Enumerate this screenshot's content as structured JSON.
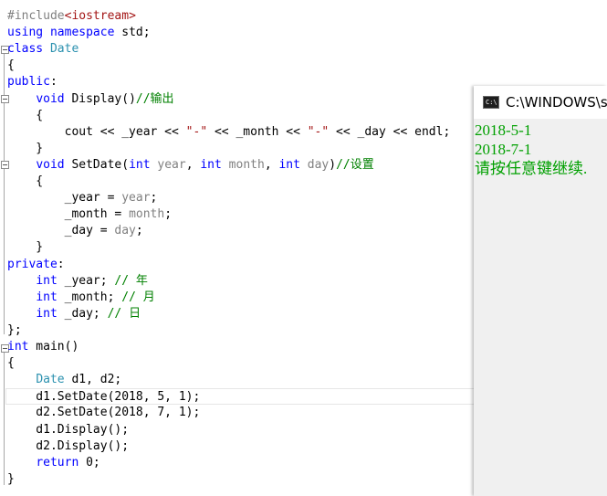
{
  "editor": {
    "lines": [
      [
        [
          "pp",
          "#include"
        ],
        [
          "st",
          "<iostream>"
        ]
      ],
      [
        [
          "kw",
          "using"
        ],
        [
          "tx",
          " "
        ],
        [
          "kw",
          "namespace"
        ],
        [
          "tx",
          " std;"
        ]
      ],
      [
        [
          "kw",
          "class"
        ],
        [
          "tx",
          " "
        ],
        [
          "ty",
          "Date"
        ]
      ],
      [
        [
          "tx",
          "{"
        ]
      ],
      [
        [
          "kw",
          "public"
        ],
        [
          "tx",
          ":"
        ]
      ],
      [
        [
          "tx",
          "    "
        ],
        [
          "kw",
          "void"
        ],
        [
          "tx",
          " Display()"
        ],
        [
          "cm",
          "//输出"
        ]
      ],
      [
        [
          "tx",
          "    {"
        ]
      ],
      [
        [
          "tx",
          "        cout << _year << "
        ],
        [
          "st",
          "\"-\""
        ],
        [
          "tx",
          " << _month << "
        ],
        [
          "st",
          "\"-\""
        ],
        [
          "tx",
          " << _day << endl;"
        ]
      ],
      [
        [
          "tx",
          "    }"
        ]
      ],
      [
        [
          "tx",
          "    "
        ],
        [
          "kw",
          "void"
        ],
        [
          "tx",
          " SetDate("
        ],
        [
          "kw",
          "int"
        ],
        [
          "tx",
          " "
        ],
        [
          "pa",
          "year"
        ],
        [
          "tx",
          ", "
        ],
        [
          "kw",
          "int"
        ],
        [
          "tx",
          " "
        ],
        [
          "pa",
          "month"
        ],
        [
          "tx",
          ", "
        ],
        [
          "kw",
          "int"
        ],
        [
          "tx",
          " "
        ],
        [
          "pa",
          "day"
        ],
        [
          "tx",
          ")"
        ],
        [
          "cm",
          "//设置"
        ]
      ],
      [
        [
          "tx",
          "    {"
        ]
      ],
      [
        [
          "tx",
          "        _year = "
        ],
        [
          "pa",
          "year"
        ],
        [
          "tx",
          ";"
        ]
      ],
      [
        [
          "tx",
          "        _month = "
        ],
        [
          "pa",
          "month"
        ],
        [
          "tx",
          ";"
        ]
      ],
      [
        [
          "tx",
          "        _day = "
        ],
        [
          "pa",
          "day"
        ],
        [
          "tx",
          ";"
        ]
      ],
      [
        [
          "tx",
          "    }"
        ]
      ],
      [
        [
          "kw",
          "private"
        ],
        [
          "tx",
          ":"
        ]
      ],
      [
        [
          "tx",
          "    "
        ],
        [
          "kw",
          "int"
        ],
        [
          "tx",
          " _year; "
        ],
        [
          "cm",
          "// 年"
        ]
      ],
      [
        [
          "tx",
          "    "
        ],
        [
          "kw",
          "int"
        ],
        [
          "tx",
          " _month; "
        ],
        [
          "cm",
          "// 月"
        ]
      ],
      [
        [
          "tx",
          "    "
        ],
        [
          "kw",
          "int"
        ],
        [
          "tx",
          " _day; "
        ],
        [
          "cm",
          "// 日"
        ]
      ],
      [
        [
          "tx",
          "};"
        ]
      ],
      [
        [
          "kw",
          "int"
        ],
        [
          "tx",
          " main()"
        ]
      ],
      [
        [
          "tx",
          "{"
        ]
      ],
      [
        [
          "tx",
          "    "
        ],
        [
          "ty",
          "Date"
        ],
        [
          "tx",
          " d1, d2;"
        ]
      ],
      [
        [
          "tx",
          "    d1.SetDate(2018, 5, 1);"
        ]
      ],
      [
        [
          "tx",
          "    d2.SetDate(2018, 7, 1);"
        ]
      ],
      [
        [
          "tx",
          "    d1.Display();"
        ]
      ],
      [
        [
          "tx",
          "    d2.Display();"
        ]
      ],
      [
        [
          "tx",
          "    "
        ],
        [
          "kw",
          "return"
        ],
        [
          "tx",
          " 0;"
        ]
      ],
      [
        [
          "tx",
          "}"
        ]
      ]
    ],
    "highlighted_line": 23,
    "colors": {
      "keyword": "#0000ff",
      "type": "#2b91af",
      "parameter": "#808080",
      "comment": "#008000",
      "string": "#a31515",
      "preprocessor": "#808080"
    }
  },
  "console": {
    "title": "C:\\WINDOWS\\s",
    "icon": "cmd-icon",
    "icon_text": "C:\\",
    "output": [
      "2018-5-1",
      "2018-7-1",
      "请按任意键继续."
    ],
    "output_color": "#00a000"
  }
}
